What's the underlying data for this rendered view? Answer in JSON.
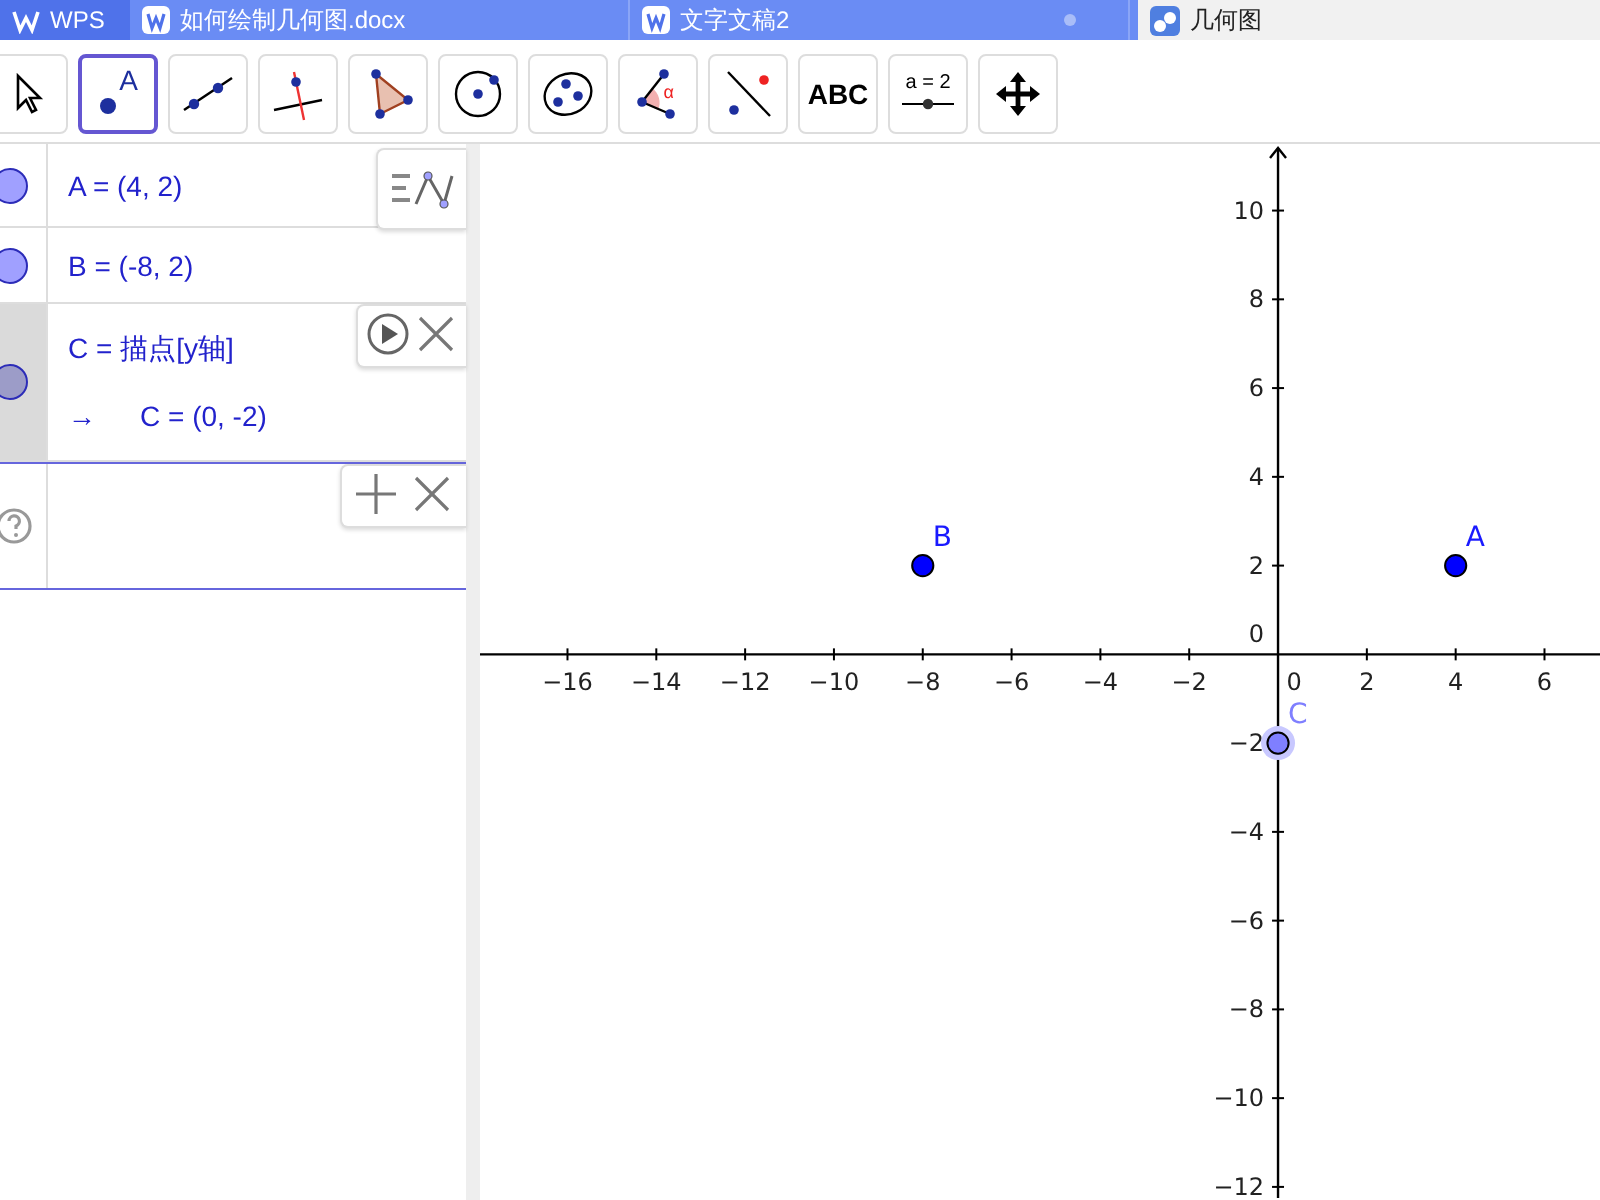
{
  "tabs": [
    {
      "kind": "home",
      "label": "WPS",
      "selected": false,
      "modified": false
    },
    {
      "kind": "doc",
      "label": "如何绘制几何图.docx",
      "selected": false,
      "modified": false
    },
    {
      "kind": "doc",
      "label": "文字文稿2",
      "selected": false,
      "modified": true
    },
    {
      "kind": "app",
      "label": "几何图",
      "selected": true,
      "modified": false
    }
  ],
  "toolbar": {
    "tools": [
      {
        "kind": "move",
        "selected": false
      },
      {
        "kind": "point",
        "label": "A",
        "selected": true
      },
      {
        "kind": "line",
        "selected": false
      },
      {
        "kind": "perpendicular",
        "selected": false
      },
      {
        "kind": "polygon",
        "selected": false
      },
      {
        "kind": "circle",
        "selected": false
      },
      {
        "kind": "conic",
        "selected": false
      },
      {
        "kind": "angle",
        "label": "α",
        "selected": false
      },
      {
        "kind": "reflect",
        "selected": false
      },
      {
        "kind": "text",
        "label": "ABC",
        "selected": false
      },
      {
        "kind": "slider",
        "label": "a = 2",
        "selected": false
      },
      {
        "kind": "pan",
        "selected": false
      }
    ]
  },
  "algebra": {
    "items": [
      {
        "kind": "point",
        "text": "A = (4, 2)",
        "color": "#a0a0ff",
        "selected": false
      },
      {
        "kind": "point",
        "text": "B = (-8, 2)",
        "color": "#a0a0ff",
        "selected": false
      },
      {
        "kind": "point",
        "text": "C = 描点[y轴]",
        "arrow": "→",
        "value": "C = (0, -2)",
        "color": "#9c9cc8",
        "selected": true
      }
    ]
  },
  "graphics": {
    "origin_labels": {
      "x_axis": "0",
      "y_axis": "0"
    },
    "chart_data": {
      "type": "scatter",
      "xlim": [
        -17.97,
        7.25
      ],
      "ylim": [
        -12.25,
        11.5
      ],
      "xticks": [
        -16,
        -14,
        -12,
        -10,
        -8,
        -6,
        -4,
        -2,
        2,
        4,
        6
      ],
      "yticks": [
        -12,
        -10,
        -8,
        -6,
        -4,
        -2,
        2,
        4,
        6,
        8,
        10
      ],
      "series": [
        {
          "name": "A",
          "color": "#0000ff",
          "x": [
            4
          ],
          "values": [
            2
          ]
        },
        {
          "name": "B",
          "color": "#0000ff",
          "x": [
            -8
          ],
          "values": [
            2
          ]
        },
        {
          "name": "C",
          "color": "#7f7fff",
          "x": [
            0
          ],
          "values": [
            -2
          ]
        }
      ]
    }
  }
}
